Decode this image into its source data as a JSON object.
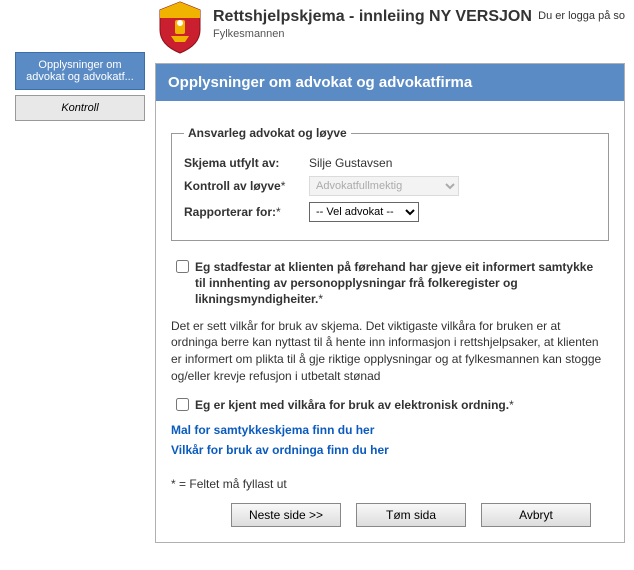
{
  "header": {
    "title": "Rettshjelpskjema - innleiing NY VERSJON",
    "subtitle": "Fylkesmannen",
    "login_status": "Du er logga på so"
  },
  "sidebar": {
    "active_label": "Opplysninger om advokat og advokatf...",
    "kontroll_label": "Kontroll"
  },
  "section": {
    "heading": "Opplysninger om advokat og advokatfirma"
  },
  "fieldset": {
    "legend": "Ansvarleg advokat og løyve",
    "filled_by_label": "Skjema utfylt av:",
    "filled_by_value": "Silje Gustavsen",
    "control_label": "Kontroll av løyve",
    "control_value": "Advokatfullmektig",
    "reports_label": "Rapporterar for:",
    "reports_value": "-- Vel advokat --"
  },
  "consent_checkbox": "Eg stadfestar at klienten på førehand har gjeve eit informert samtykke til innhenting av personopplysningar frå folkeregister og likningsmyndigheiter.",
  "info_paragraph": "Det er sett vilkår for bruk av skjema. Det viktigaste vilkåra for bruken er at ordninga berre kan nyttast til å hente inn informasjon i rettshjelpsaker, at klienten er informert om plikta til å gje riktige opplysningar og at fylkesmannen kan stogge og/eller krevje refusjon i utbetalt stønad",
  "terms_checkbox": "Eg er kjent med vilkåra for bruk av elektronisk ordning.",
  "link_template": "Mal for samtykkeskjema finn du her",
  "link_terms": "Vilkår for bruk av ordninga finn du her",
  "footnote": "= Feltet må fyllast ut",
  "buttons": {
    "next": "Neste side >>",
    "clear": "Tøm sida",
    "cancel": "Avbryt"
  },
  "asterisk": "*"
}
